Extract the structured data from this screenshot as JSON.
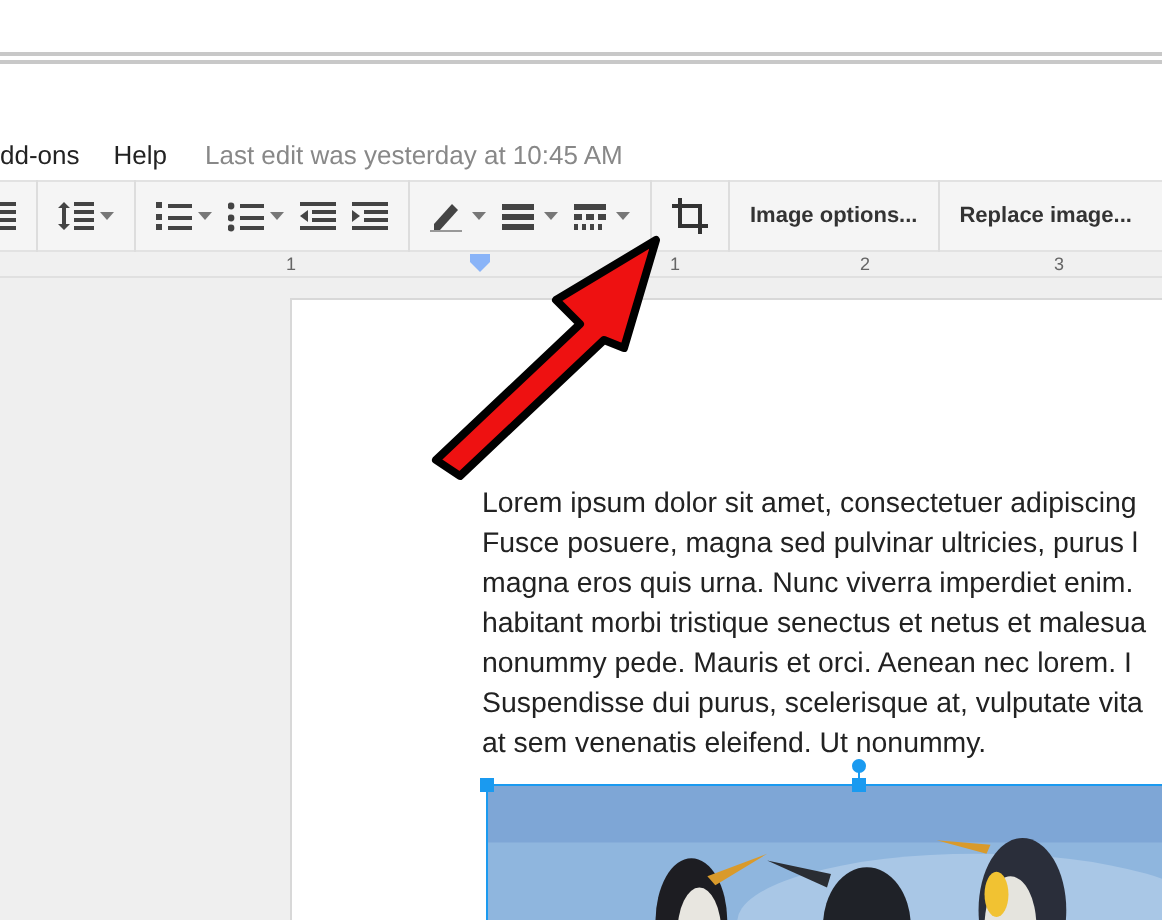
{
  "menu": {
    "items": [
      "dd-ons",
      "Help"
    ],
    "status": "Last edit was yesterday at 10:45 AM"
  },
  "toolbar": {
    "items": [
      {
        "kind": "icon",
        "caret": false
      },
      {
        "kind": "sep"
      },
      {
        "kind": "icon",
        "caret": true
      },
      {
        "kind": "sep"
      },
      {
        "kind": "icon",
        "caret": true
      },
      {
        "kind": "icon",
        "caret": true
      },
      {
        "kind": "icon",
        "caret": false
      },
      {
        "kind": "icon",
        "caret": false
      },
      {
        "kind": "sep"
      },
      {
        "kind": "icon",
        "caret": true
      },
      {
        "kind": "icon",
        "caret": true
      },
      {
        "kind": "icon",
        "caret": true
      },
      {
        "kind": "sep"
      },
      {
        "kind": "icon",
        "caret": false
      },
      {
        "kind": "sep"
      },
      {
        "kind": "text",
        "label": "Image options..."
      },
      {
        "kind": "sep"
      },
      {
        "kind": "text",
        "label": "Replace image..."
      }
    ]
  },
  "ruler": {
    "marks": [
      "1",
      "1",
      "2",
      "3"
    ]
  },
  "document": {
    "lines": [
      "Lorem ipsum dolor sit amet, consectetuer adipiscing",
      "Fusce posuere, magna sed pulvinar ultricies, purus l",
      "magna eros quis urna. Nunc viverra imperdiet enim.",
      "habitant morbi tristique senectus et netus et malesua",
      "nonummy pede. Mauris et orci. Aenean nec lorem. I",
      "Suspendisse dui purus, scelerisque at, vulputate vita",
      "at sem venenatis eleifend. Ut nonummy."
    ],
    "image": {
      "kind": "picture",
      "selected": true
    }
  }
}
